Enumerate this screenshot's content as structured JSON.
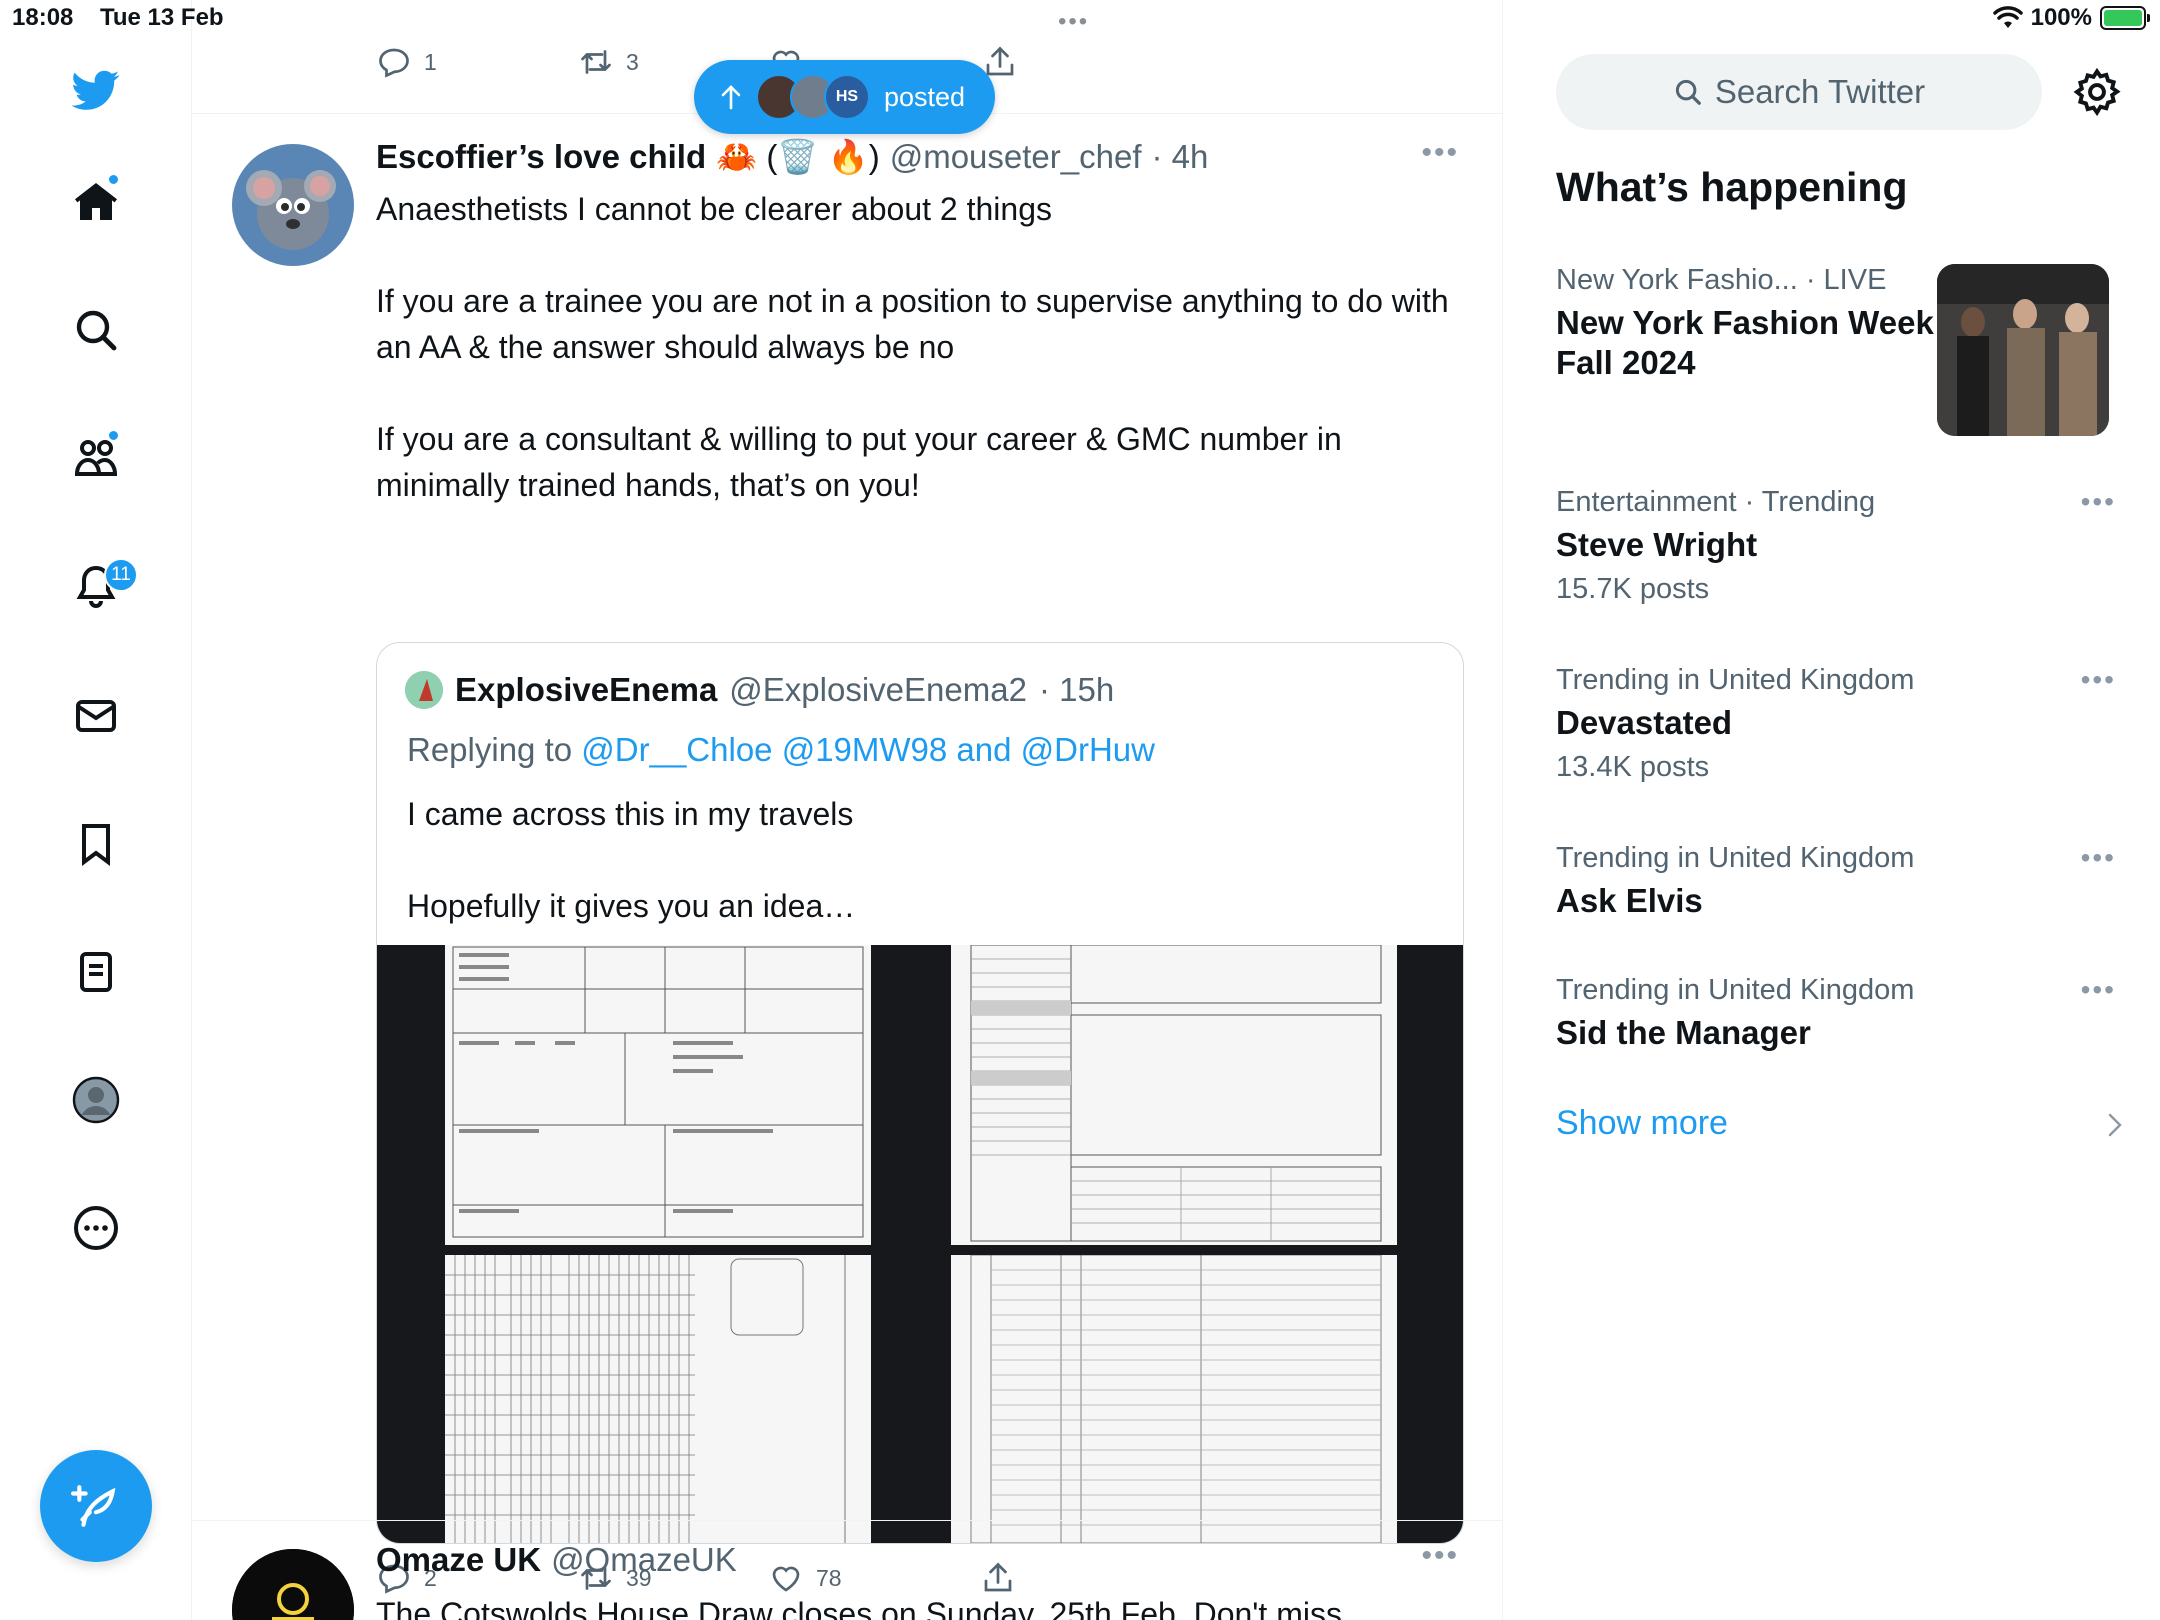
{
  "status": {
    "time": "18:08",
    "date": "Tue 13 Feb",
    "battery": "100%",
    "battery_level": 1.0
  },
  "nav": {
    "notifications_badge": "11"
  },
  "top_actions": {
    "replies": "1",
    "retweets": "3"
  },
  "posted_pill": {
    "label": "posted",
    "avatar_text": "HS"
  },
  "tweet": {
    "name": "Escoffier’s love child",
    "emoji": "🦀 (🗑️ 🔥)",
    "handle": "@mouseter_chef",
    "time": "· 4h",
    "text": "Anaesthetists I cannot be clearer about 2 things\n\nIf you are a trainee you are not in a position to supervise anything to do with an AA & the answer should always be no\n\nIf you are a consultant & willing to put your career & GMC number in minimally trained hands, that’s on you!",
    "replies": "2",
    "retweets": "39",
    "likes": "78"
  },
  "quote": {
    "name": "ExplosiveEnema",
    "handle": "@ExplosiveEnema2",
    "time": "· 15h",
    "replying_prefix": "Replying to",
    "replying_to": "@Dr__Chloe @19MW98 and @DrHuw",
    "text": "I came across this in my travels\n\nHopefully it gives you an idea…"
  },
  "next_tweet": {
    "name": "Omaze UK",
    "handle": "@OmazeUK",
    "text": "The Cotswolds House Draw closes on Sunday, 25th Feb. Don't miss"
  },
  "sidebar": {
    "search_placeholder": "Search Twitter",
    "title": "What’s happening",
    "trends": [
      {
        "meta": "New York Fashio...  · LIVE",
        "title": "New York Fashion Week Fall 2024",
        "count": ""
      },
      {
        "meta": "Entertainment · Trending",
        "title": "Steve Wright",
        "count": "15.7K posts"
      },
      {
        "meta": "Trending in United Kingdom",
        "title": "Devastated",
        "count": "13.4K posts"
      },
      {
        "meta": "Trending in United Kingdom",
        "title": "Ask Elvis",
        "count": ""
      },
      {
        "meta": "Trending in United Kingdom",
        "title": "Sid the Manager",
        "count": ""
      }
    ],
    "show_more": "Show more"
  },
  "colors": {
    "accent": "#1d9bf0",
    "text": "#0f1419",
    "muted": "#536471"
  },
  "icons": [
    "twitter-logo-icon",
    "home-icon",
    "search-icon",
    "communities-icon",
    "bell-icon",
    "mail-icon",
    "bookmark-icon",
    "lists-icon",
    "profile-icon",
    "more-icon",
    "compose-icon",
    "reply-icon",
    "retweet-icon",
    "like-icon",
    "share-icon",
    "gear-icon",
    "chevron-right-icon"
  ]
}
